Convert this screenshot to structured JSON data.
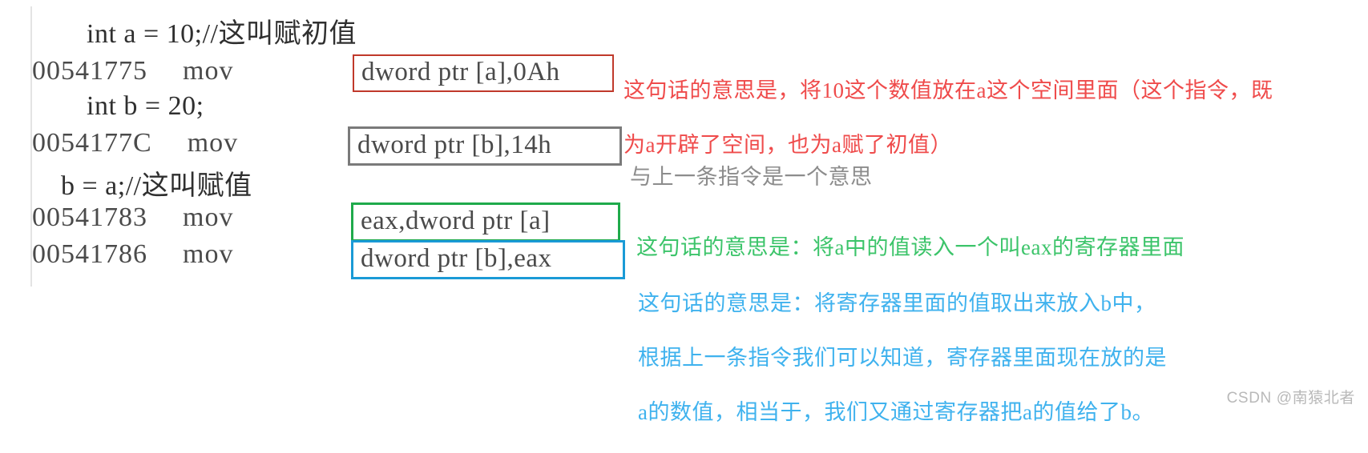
{
  "document": {
    "type": "disassembly-annotated-screenshot",
    "watermark": "CSDN @南猿北者"
  },
  "colors": {
    "red": "#ef4b4b",
    "gray": "#8c8c8c",
    "green": "#3cc46a",
    "blue": "#3fb2ee",
    "code": "#4a4a4a",
    "background": "#ffffff"
  },
  "code_lines": [
    {
      "kind": "source",
      "text": "int a = 10;//这叫赋初值"
    },
    {
      "kind": "asm",
      "address": "00541775",
      "mnemonic": "mov",
      "operands": "dword ptr [a],0Ah",
      "box_color": "red"
    },
    {
      "kind": "source",
      "text": "int b = 20;"
    },
    {
      "kind": "asm",
      "address": "0054177C",
      "mnemonic": "mov",
      "operands": "dword ptr [b],14h",
      "box_color": "gray"
    },
    {
      "kind": "source",
      "text": "b = a;//这叫赋值"
    },
    {
      "kind": "asm",
      "address": "00541783",
      "mnemonic": "mov",
      "operands": "eax,dword ptr [a]",
      "box_color": "green"
    },
    {
      "kind": "asm",
      "address": "00541786",
      "mnemonic": "mov",
      "operands": "dword ptr [b],eax",
      "box_color": "blue"
    }
  ],
  "annotations": [
    {
      "color": "red",
      "lines": [
        "这句话的意思是，将10这个数值放在a这个空间里面（这个指令，既",
        "为a开辟了空间，也为a赋了初值）"
      ]
    },
    {
      "color": "gray",
      "lines": [
        "与上一条指令是一个意思"
      ]
    },
    {
      "color": "green",
      "lines": [
        "这句话的意思是：将a中的值读入一个叫eax的寄存器里面"
      ]
    },
    {
      "color": "blue",
      "lines": [
        "这句话的意思是：将寄存器里面的值取出来放入b中，",
        "根据上一条指令我们可以知道，寄存器里面现在放的是",
        "a的数值，相当于，我们又通过寄存器把a的值给了b。"
      ]
    }
  ],
  "stray_glyph": "a"
}
